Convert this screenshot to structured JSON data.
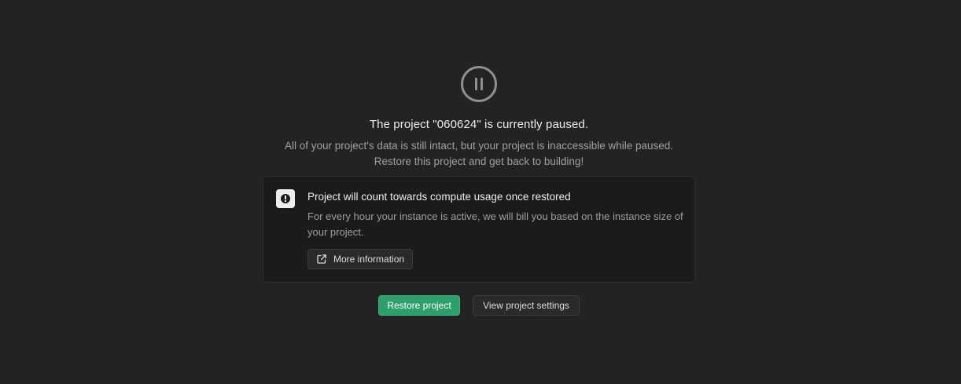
{
  "paused": {
    "icon": "pause-circle-icon",
    "title": "The project \"060624\" is currently paused.",
    "subtitle_line1": "All of your project's data is still intact, but your project is inaccessible while paused.",
    "subtitle_line2": "Restore this project and get back to building!"
  },
  "notice": {
    "icon": "alert-icon",
    "title": "Project will count towards compute usage once restored",
    "body": "For every hour your instance is active, we will bill you based on the instance size of your project.",
    "more_button": {
      "icon": "external-link-icon",
      "label": "More information"
    }
  },
  "actions": {
    "restore_label": "Restore project",
    "settings_label": "View project settings"
  },
  "colors": {
    "background": "#232323",
    "card": "#1b1b1b",
    "accent": "#2d9f6a"
  }
}
